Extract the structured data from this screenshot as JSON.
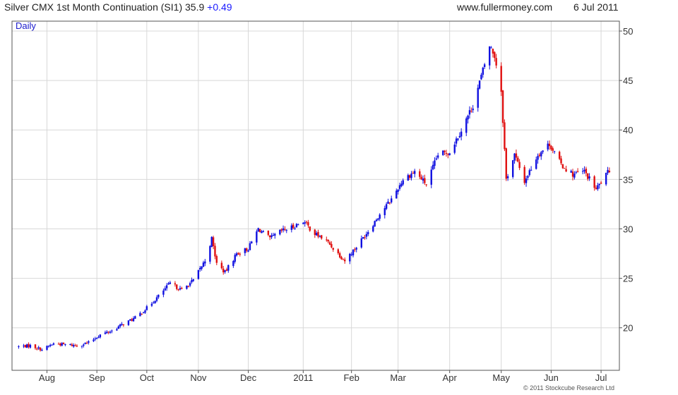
{
  "header": {
    "title": "Silver CMX 1st Month Continuation (SI1) 35.9",
    "change": "+0.49",
    "website": "www.fullermoney.com",
    "date": "6 Jul 2011"
  },
  "copyright": "© 2011 Stockcube Research Ltd",
  "colors": {
    "up": "#1010e0",
    "down": "#e01010",
    "grid": "#d8d8d8",
    "frame": "#555555"
  },
  "chart_data": {
    "type": "candlestick",
    "period_label": "Daily",
    "x_tick_labels": [
      "Aug",
      "Sep",
      "Oct",
      "Nov",
      "Dec",
      "2011",
      "Feb",
      "Mar",
      "Apr",
      "May",
      "Jun",
      "Jul"
    ],
    "y_ticks": [
      20,
      25,
      30,
      35,
      40,
      45,
      50
    ],
    "ylim": [
      15.7,
      51.0
    ],
    "y_axis_side": "right",
    "grid": true,
    "legend": "none",
    "series": [
      {
        "name": "SI1",
        "points": [
          [
            "2010-07-16",
            18.1
          ],
          [
            "2010-07-23",
            18.2
          ],
          [
            "2010-07-30",
            17.8
          ],
          [
            "2010-08-06",
            18.4
          ],
          [
            "2010-08-13",
            18.3
          ],
          [
            "2010-08-20",
            18.2
          ],
          [
            "2010-08-27",
            18.5
          ],
          [
            "2010-09-03",
            19.3
          ],
          [
            "2010-09-10",
            19.7
          ],
          [
            "2010-09-17",
            20.4
          ],
          [
            "2010-09-24",
            21.0
          ],
          [
            "2010-10-01",
            22.0
          ],
          [
            "2010-10-08",
            23.2
          ],
          [
            "2010-10-15",
            24.5
          ],
          [
            "2010-10-22",
            23.8
          ],
          [
            "2010-10-29",
            24.8
          ],
          [
            "2010-11-05",
            26.8
          ],
          [
            "2010-11-09",
            29.0
          ],
          [
            "2010-11-12",
            26.5
          ],
          [
            "2010-11-17",
            25.6
          ],
          [
            "2010-11-24",
            27.5
          ],
          [
            "2010-12-01",
            28.0
          ],
          [
            "2010-12-07",
            30.0
          ],
          [
            "2010-12-14",
            29.0
          ],
          [
            "2010-12-21",
            29.8
          ],
          [
            "2010-12-28",
            30.2
          ],
          [
            "2011-01-03",
            30.8
          ],
          [
            "2011-01-10",
            29.5
          ],
          [
            "2011-01-17",
            28.8
          ],
          [
            "2011-01-24",
            27.5
          ],
          [
            "2011-01-28",
            26.8
          ],
          [
            "2011-02-04",
            28.2
          ],
          [
            "2011-02-11",
            29.8
          ],
          [
            "2011-02-18",
            31.5
          ],
          [
            "2011-02-25",
            33.0
          ],
          [
            "2011-03-04",
            35.0
          ],
          [
            "2011-03-11",
            35.8
          ],
          [
            "2011-03-18",
            34.5
          ],
          [
            "2011-03-25",
            37.5
          ],
          [
            "2011-04-01",
            37.8
          ],
          [
            "2011-04-08",
            40.0
          ],
          [
            "2011-04-15",
            42.5
          ],
          [
            "2011-04-21",
            46.0
          ],
          [
            "2011-04-25",
            48.5
          ],
          [
            "2011-04-28",
            47.5
          ],
          [
            "2011-05-02",
            44.0
          ],
          [
            "2011-05-05",
            35.0
          ],
          [
            "2011-05-10",
            37.5
          ],
          [
            "2011-05-16",
            34.8
          ],
          [
            "2011-05-24",
            37.5
          ],
          [
            "2011-05-31",
            38.6
          ],
          [
            "2011-06-07",
            36.5
          ],
          [
            "2011-06-14",
            35.5
          ],
          [
            "2011-06-21",
            35.8
          ],
          [
            "2011-06-28",
            34.0
          ],
          [
            "2011-07-06",
            35.9
          ]
        ]
      }
    ]
  }
}
